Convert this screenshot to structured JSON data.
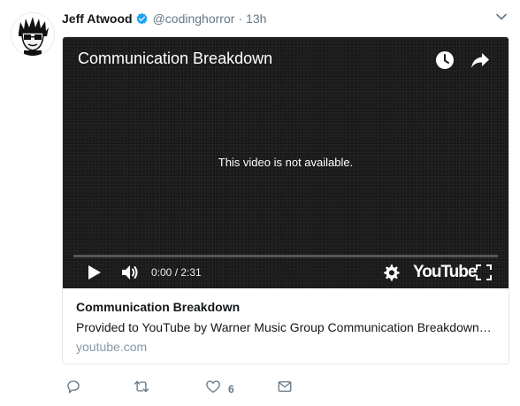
{
  "tweet": {
    "author_name": "Jeff Atwood",
    "handle": "@codinghorror",
    "separator": "·",
    "time": "13h"
  },
  "video": {
    "title": "Communication Breakdown",
    "message": "This video is not available.",
    "timecode": "0:00 / 2:31",
    "progress": 0,
    "logo_text": "YouTube"
  },
  "card": {
    "title": "Communication Breakdown",
    "description": "Provided to YouTube by Warner Music Group Communication Breakdown…",
    "domain": "youtube.com"
  },
  "actions": {
    "like_count": "6"
  },
  "colors": {
    "verified": "#1da1f2",
    "muted": "#657786",
    "border": "#e1e8ed"
  }
}
